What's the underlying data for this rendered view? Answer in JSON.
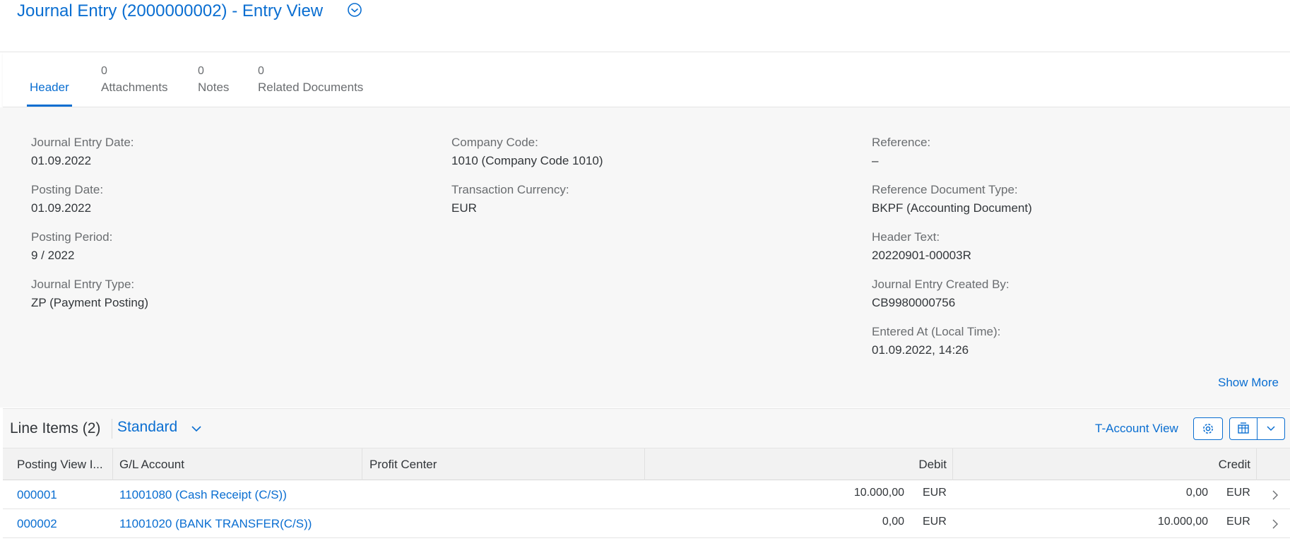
{
  "page": {
    "title": "Journal Entry (2000000002) - Entry View"
  },
  "tabs": [
    {
      "count": "",
      "label": "Header"
    },
    {
      "count": "0",
      "label": "Attachments"
    },
    {
      "count": "0",
      "label": "Notes"
    },
    {
      "count": "0",
      "label": "Related Documents"
    }
  ],
  "header": {
    "col1": [
      {
        "label": "Journal Entry Date:",
        "value": "01.09.2022"
      },
      {
        "label": "Posting Date:",
        "value": "01.09.2022"
      },
      {
        "label": "Posting Period:",
        "value": "9 / 2022"
      },
      {
        "label": "Journal Entry Type:",
        "value": "ZP (Payment Posting)"
      }
    ],
    "col2": [
      {
        "label": "Company Code:",
        "value": "1010 (Company Code 1010)"
      },
      {
        "label": "Transaction Currency:",
        "value": "EUR"
      }
    ],
    "col3": [
      {
        "label": "Reference:",
        "value": "–"
      },
      {
        "label": "Reference Document Type:",
        "value": "BKPF (Accounting Document)"
      },
      {
        "label": "Header Text:",
        "value": "20220901-00003R"
      },
      {
        "label": "Journal Entry Created By:",
        "value": "CB9980000756"
      },
      {
        "label": "Entered At (Local Time):",
        "value": "01.09.2022, 14:26"
      }
    ],
    "show_more": "Show More"
  },
  "line_items": {
    "title": "Line Items (2)",
    "variant": "Standard",
    "t_account_view": "T-Account View",
    "columns": {
      "posting_view_item": "Posting View I...",
      "gl_account": "G/L Account",
      "profit_center": "Profit Center",
      "debit": "Debit",
      "credit": "Credit"
    },
    "rows": [
      {
        "item": "000001",
        "gl_account": "11001080 (Cash Receipt (C/S))",
        "profit_center": "",
        "debit": "10.000,00",
        "debit_currency": "EUR",
        "credit": "0,00",
        "credit_currency": "EUR"
      },
      {
        "item": "000002",
        "gl_account": "11001020 (BANK TRANSFER(C/S))",
        "profit_center": "",
        "debit": "0,00",
        "debit_currency": "EUR",
        "credit": "10.000,00",
        "credit_currency": "EUR"
      }
    ]
  },
  "colors": {
    "accent": "#0a6ed1",
    "text": "#32363a",
    "label": "#6a6d70"
  },
  "icons": {
    "title_menu": "chevron-down-circle-icon",
    "variant_menu": "chevron-down-icon",
    "settings": "gear-icon",
    "export": "export-spreadsheet-icon",
    "export_menu": "chevron-down-icon",
    "row_navigation": "chevron-right-icon"
  }
}
